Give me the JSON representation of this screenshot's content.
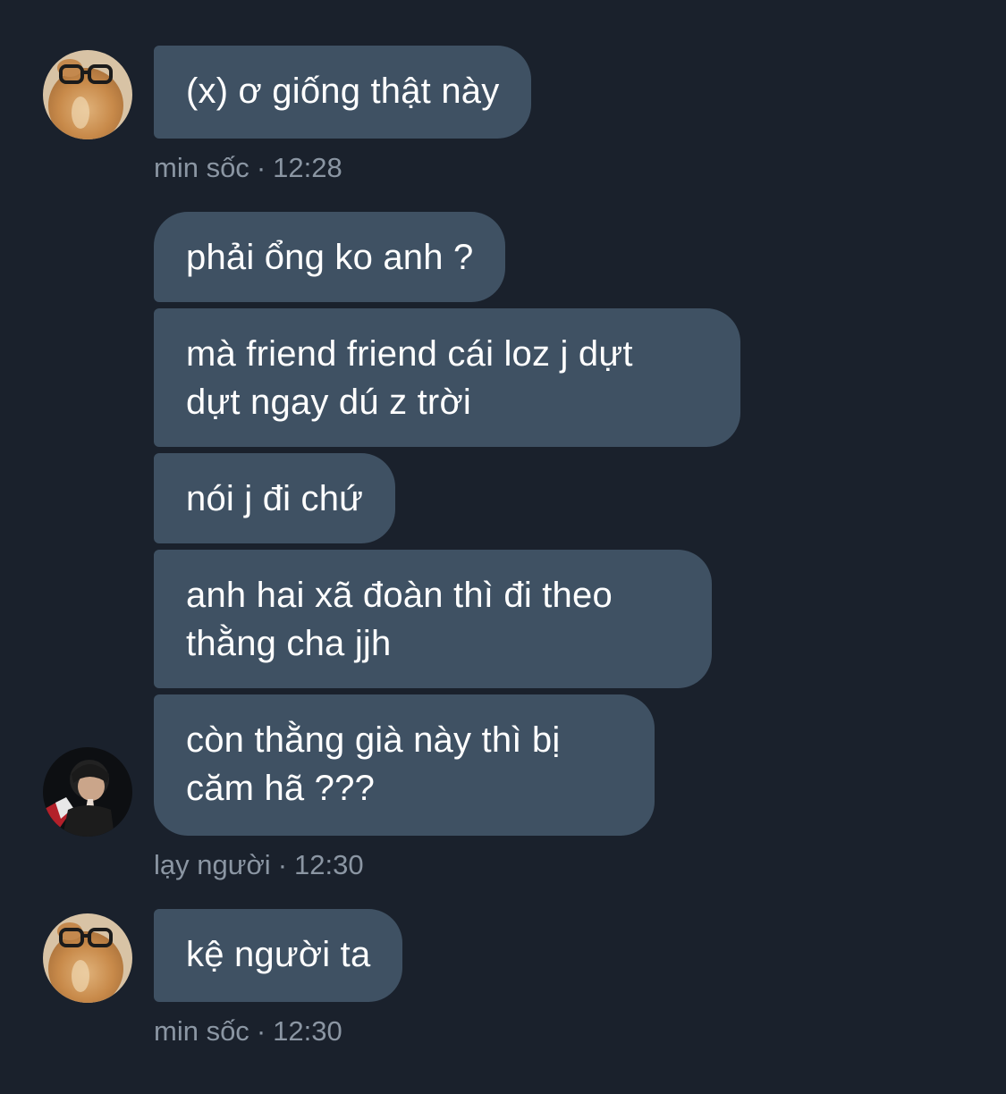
{
  "groups": [
    {
      "sender": "min sốc",
      "time": "12:28",
      "messages": [
        "(x) ơ giống thật này"
      ]
    },
    {
      "sender": "lạy người",
      "time": "12:30",
      "messages": [
        "phải ổng ko anh ?",
        "mà friend friend cái loz j dựt\ndựt ngay dú z trời",
        "nói j đi chứ",
        "anh hai xã đoàn thì đi theo\nthằng cha jjh",
        "còn thằng già này thì bị\ncăm hã ???"
      ]
    },
    {
      "sender": "min sốc",
      "time": "12:30",
      "messages": [
        "kệ người ta"
      ]
    }
  ],
  "meta_separator": "·",
  "colors": {
    "background": "#1a212c",
    "bubble": "#3f5163",
    "meta_text": "#8b96a3"
  }
}
